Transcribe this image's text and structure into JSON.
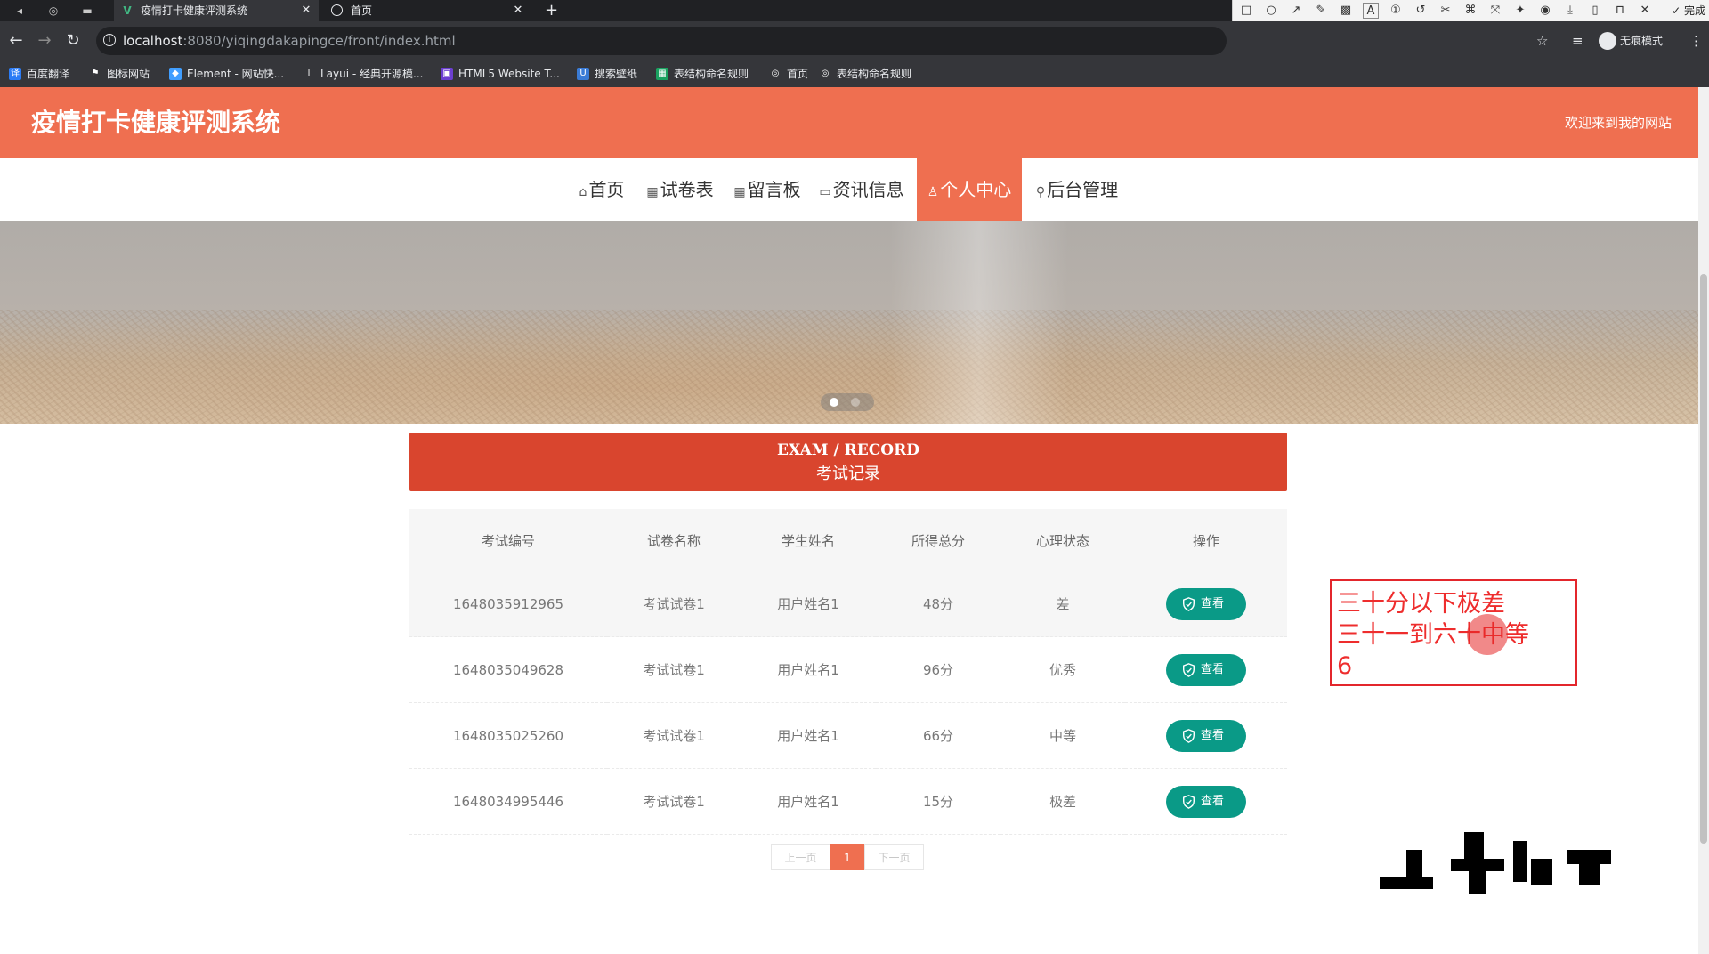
{
  "browser": {
    "tabs": [
      {
        "title": "疫情打卡健康评测系统",
        "icon": "vue-icon"
      },
      {
        "title": "首页",
        "icon": "globe-icon"
      }
    ],
    "new_tab_label": "+",
    "url": {
      "host": "localhost",
      "path": ":8080/yiqingdakapingce/front/index.html"
    },
    "incognito_label": "无痕模式",
    "bookmarks": [
      {
        "label": "百度翻译",
        "color": "#2b7cf6",
        "glyph": "译"
      },
      {
        "label": "图标网站",
        "color": "#35363a",
        "glyph": "⚑"
      },
      {
        "label": "Element - 网站快...",
        "color": "#409eff",
        "glyph": "◆"
      },
      {
        "label": "Layui - 经典开源模...",
        "color": "#35363a",
        "glyph": "l"
      },
      {
        "label": "HTML5 Website T...",
        "color": "#6c3fd1",
        "glyph": "▣"
      },
      {
        "label": "搜索壁纸",
        "color": "#3a7bd5",
        "glyph": "U"
      },
      {
        "label": "表结构命名规则",
        "color": "#1aa260",
        "glyph": "▦"
      },
      {
        "label": "首页",
        "color": "#35363a",
        "glyph": "◎"
      },
      {
        "label": "表结构命名规则",
        "color": "#35363a",
        "glyph": "◎"
      }
    ]
  },
  "annotation_toolbar": {
    "font_size": "20",
    "done_label": "✓ 完成",
    "current_color": "#ff2b2b",
    "swatches": [
      "#000000",
      "#7f7f7f",
      "#880015",
      "#ed1c24",
      "#ff7f27",
      "#22b14c",
      "#3f48cc",
      "#a349a4",
      "#00a2e8",
      "#ffffff",
      "#c3c3c3",
      "#b97a57",
      "#ffaec9",
      "#ffc90e",
      "#b5e61d",
      "#7092be",
      "#e040fb",
      "#26c6da"
    ]
  },
  "site": {
    "title": "疫情打卡健康评测系统",
    "welcome": "欢迎来到我的网站",
    "accent_color": "#ef6f50",
    "nav": [
      {
        "label": "首页",
        "icon": "home-icon",
        "glyph": "⌂",
        "active": false
      },
      {
        "label": "试卷表",
        "icon": "grid-icon",
        "glyph": "▦",
        "active": false
      },
      {
        "label": "留言板",
        "icon": "board-icon",
        "glyph": "▦",
        "active": false
      },
      {
        "label": "资讯信息",
        "icon": "calendar-icon",
        "glyph": "▭",
        "active": false
      },
      {
        "label": "个人中心",
        "icon": "user-icon",
        "glyph": "♙",
        "active": true
      },
      {
        "label": "后台管理",
        "icon": "link-icon",
        "glyph": "⚲",
        "active": false
      }
    ]
  },
  "section": {
    "title_en": "EXAM / RECORD",
    "title_zh": "考试记录"
  },
  "table": {
    "columns": [
      "考试编号",
      "试卷名称",
      "学生姓名",
      "所得总分",
      "心理状态",
      "操作"
    ],
    "rows": [
      [
        "1648035912965",
        "考试试卷1",
        "用户姓名1",
        "48分",
        "差"
      ],
      [
        "1648035049628",
        "考试试卷1",
        "用户姓名1",
        "96分",
        "优秀"
      ],
      [
        "1648035025260",
        "考试试卷1",
        "用户姓名1",
        "66分",
        "中等"
      ],
      [
        "1648034995446",
        "考试试卷1",
        "用户姓名1",
        "15分",
        "极差"
      ]
    ],
    "action_label": "查看",
    "action_color": "#0a9a87"
  },
  "pagination": {
    "prev": "上一页",
    "current": "1",
    "next": "下一页"
  },
  "annotation_note": {
    "lines": [
      "三十分以下极差",
      "三十一到六十中等",
      "6"
    ],
    "color": "#ee2d2d"
  }
}
